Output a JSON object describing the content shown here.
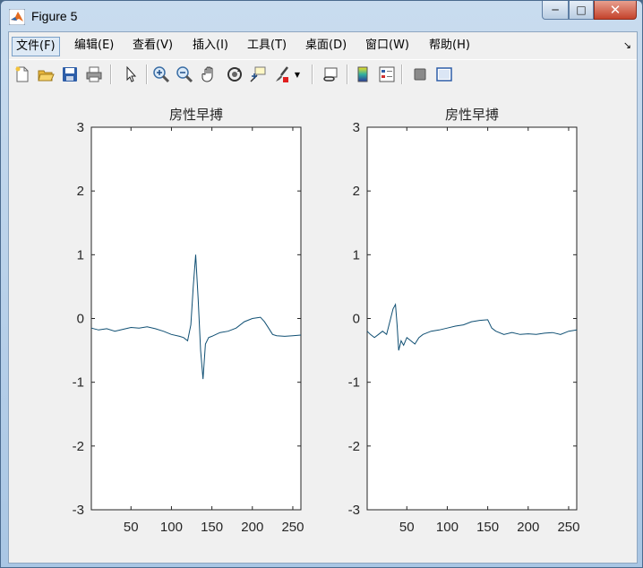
{
  "window": {
    "title": "Figure 5"
  },
  "menu": {
    "items": [
      {
        "label": "文件(F)"
      },
      {
        "label": "编辑(E)"
      },
      {
        "label": "查看(V)"
      },
      {
        "label": "插入(I)"
      },
      {
        "label": "工具(T)"
      },
      {
        "label": "桌面(D)"
      },
      {
        "label": "窗口(W)"
      },
      {
        "label": "帮助(H)"
      }
    ]
  },
  "toolbar": {
    "icons": [
      "new-figure-icon",
      "open-file-icon",
      "save-icon",
      "print-icon",
      "pointer-icon",
      "zoom-in-icon",
      "zoom-out-icon",
      "pan-hand-icon",
      "rotate-3d-icon",
      "data-cursor-icon",
      "brush-icon",
      "link-plot-icon",
      "colorbar-icon",
      "legend-icon",
      "hide-plot-tools-icon",
      "show-plot-tools-icon"
    ]
  },
  "colors": {
    "trace": "#0f4f73",
    "axes_bg": "#ffffff"
  },
  "chart_data": [
    {
      "type": "line",
      "title": "房性早搏",
      "xlim": [
        1,
        260
      ],
      "ylim": [
        -3,
        3
      ],
      "xticks": [
        "50",
        "100",
        "150",
        "200",
        "250"
      ],
      "yticks": [
        "-3",
        "-2",
        "-1",
        "0",
        "1",
        "2",
        "3"
      ],
      "x": [
        1,
        10,
        20,
        30,
        40,
        50,
        60,
        70,
        80,
        90,
        100,
        110,
        115,
        120,
        124,
        127,
        130,
        133,
        136,
        139,
        142,
        146,
        150,
        155,
        160,
        170,
        180,
        190,
        200,
        210,
        215,
        220,
        225,
        230,
        240,
        250,
        260
      ],
      "y": [
        -0.15,
        -0.18,
        -0.16,
        -0.2,
        -0.17,
        -0.14,
        -0.15,
        -0.13,
        -0.16,
        -0.2,
        -0.25,
        -0.28,
        -0.3,
        -0.35,
        -0.1,
        0.5,
        1.0,
        0.3,
        -0.5,
        -0.95,
        -0.4,
        -0.3,
        -0.28,
        -0.25,
        -0.22,
        -0.2,
        -0.15,
        -0.05,
        0.0,
        0.02,
        -0.05,
        -0.15,
        -0.25,
        -0.27,
        -0.28,
        -0.27,
        -0.26
      ]
    },
    {
      "type": "line",
      "title": "房性早搏",
      "xlim": [
        1,
        260
      ],
      "ylim": [
        -3,
        3
      ],
      "xticks": [
        "50",
        "100",
        "150",
        "200",
        "250"
      ],
      "yticks": [
        "-3",
        "-2",
        "-1",
        "0",
        "1",
        "2",
        "3"
      ],
      "x": [
        1,
        5,
        10,
        15,
        20,
        25,
        30,
        33,
        36,
        38,
        40,
        43,
        46,
        50,
        55,
        60,
        65,
        70,
        80,
        90,
        100,
        110,
        120,
        130,
        140,
        150,
        155,
        160,
        170,
        180,
        190,
        200,
        210,
        220,
        230,
        240,
        250,
        260
      ],
      "y": [
        -0.2,
        -0.25,
        -0.3,
        -0.25,
        -0.2,
        -0.25,
        0.0,
        0.15,
        0.22,
        -0.1,
        -0.5,
        -0.35,
        -0.42,
        -0.3,
        -0.35,
        -0.4,
        -0.3,
        -0.25,
        -0.2,
        -0.18,
        -0.15,
        -0.12,
        -0.1,
        -0.05,
        -0.03,
        -0.02,
        -0.15,
        -0.2,
        -0.25,
        -0.22,
        -0.25,
        -0.24,
        -0.25,
        -0.23,
        -0.22,
        -0.25,
        -0.2,
        -0.18
      ]
    }
  ]
}
